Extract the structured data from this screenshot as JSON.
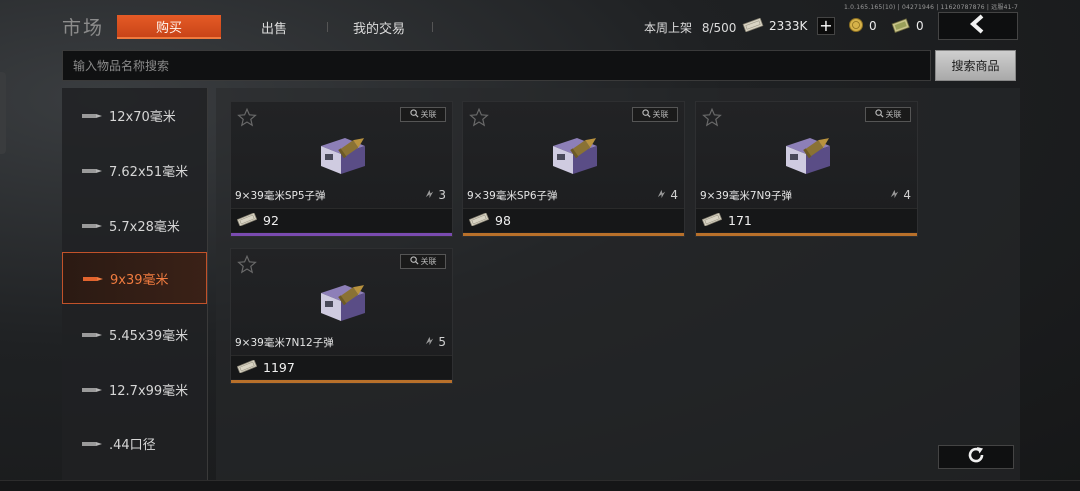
{
  "version": "1.0.165.165(10) | 04271946 | 11620787876 | 远服41-7",
  "header": {
    "title": "市场",
    "tabs": [
      {
        "label": "购买",
        "active": true
      },
      {
        "label": "出售",
        "active": false
      },
      {
        "label": "我的交易",
        "active": false
      }
    ],
    "weekly_label": "本周上架",
    "weekly_count": "8/500",
    "currency_cash": "2333K",
    "currency_coin": "0",
    "currency_ticket": "0",
    "icons": {
      "cash": "cash-icon",
      "coin": "coin-icon",
      "ticket": "ticket-icon",
      "back": "back-arrow-icon",
      "plus": "plus-icon"
    }
  },
  "search": {
    "placeholder": "输入物品名称搜索",
    "button_label": "搜索商品"
  },
  "sidebar": {
    "items": [
      {
        "label": "12x70毫米",
        "active": false
      },
      {
        "label": "7.62x51毫米",
        "active": false
      },
      {
        "label": "5.7x28毫米",
        "active": false
      },
      {
        "label": "9x39毫米",
        "active": true
      },
      {
        "label": "5.45x39毫米",
        "active": false
      },
      {
        "label": "12.7x99毫米",
        "active": false
      },
      {
        "label": ".44口径",
        "active": false
      }
    ]
  },
  "items": [
    {
      "name": "9×39毫米SP5子弹",
      "level": "3",
      "price": "92",
      "link_label": "关联",
      "rarity_color": "#7a4bb0"
    },
    {
      "name": "9×39毫米SP6子弹",
      "level": "4",
      "price": "98",
      "link_label": "关联",
      "rarity_color": "#b8702a"
    },
    {
      "name": "9×39毫米7N9子弹",
      "level": "4",
      "price": "171",
      "link_label": "关联",
      "rarity_color": "#b8702a"
    },
    {
      "name": "9×39毫米7N12子弹",
      "level": "5",
      "price": "1197",
      "link_label": "关联",
      "rarity_color": "#b8702a"
    }
  ],
  "colors": {
    "accent": "#e55b26",
    "active_text": "#f07b3f"
  }
}
